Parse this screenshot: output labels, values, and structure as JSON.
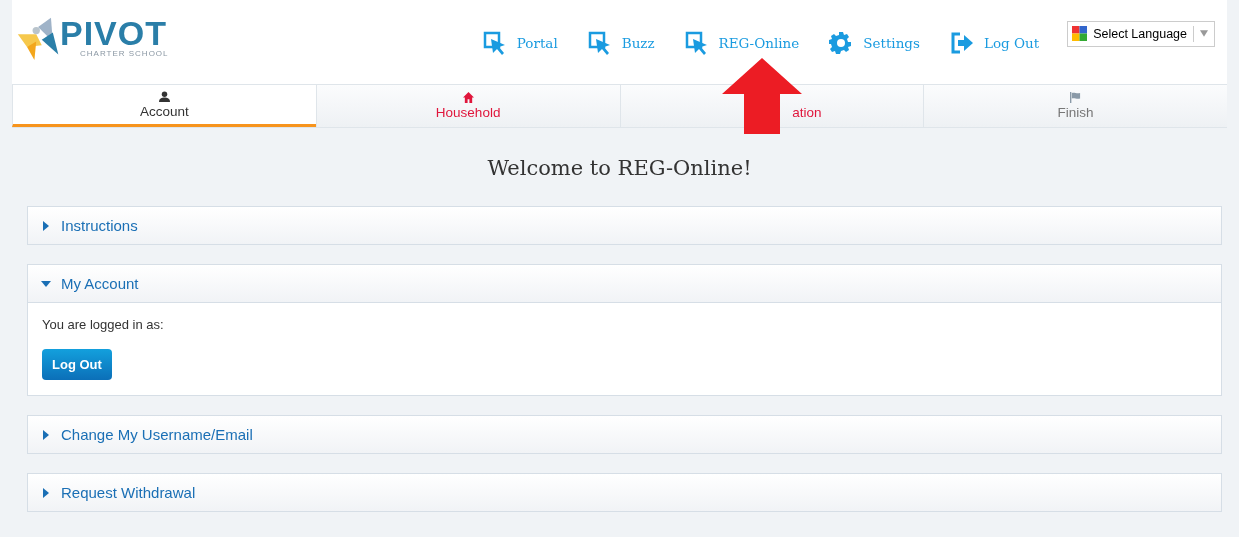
{
  "logo": {
    "name": "PIVOT",
    "tagline": "CHARTER SCHOOL"
  },
  "nav": [
    {
      "label": "Portal",
      "kind": "cursor"
    },
    {
      "label": "Buzz",
      "kind": "cursor"
    },
    {
      "label": "REG-Online",
      "kind": "cursor"
    },
    {
      "label": "Settings",
      "kind": "gear"
    },
    {
      "label": "Log Out",
      "kind": "exit"
    }
  ],
  "language_select": {
    "value": "Select Language"
  },
  "tabs": [
    {
      "label": "Account",
      "kind": "user",
      "selected": true,
      "color": "#333333"
    },
    {
      "label": "Household",
      "kind": "home",
      "selected": false,
      "color": "#e0163c"
    },
    {
      "label": "ation",
      "kind": "hidden",
      "selected": false,
      "color": "#e0163c"
    },
    {
      "label": "Finish",
      "kind": "flag",
      "selected": false,
      "color": "#777777"
    }
  ],
  "heading": "Welcome to REG-Online!",
  "panels": [
    {
      "title": "Instructions",
      "expanded": false
    },
    {
      "title": "My Account",
      "expanded": true,
      "text": "You are logged in as:",
      "button": "Log Out"
    },
    {
      "title": "Change My Username/Email",
      "expanded": false
    },
    {
      "title": "Request Withdrawal",
      "expanded": false
    }
  ]
}
